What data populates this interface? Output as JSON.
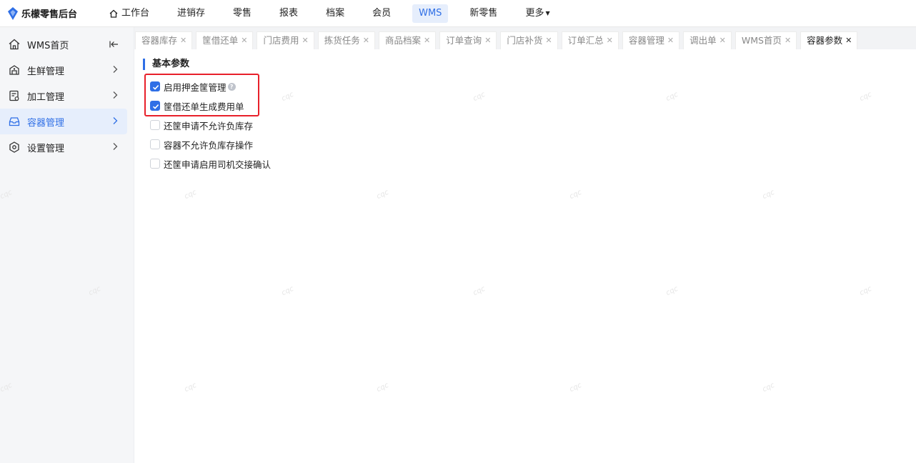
{
  "app": {
    "title": "乐檬零售后台"
  },
  "topnav": [
    {
      "label": "工作台",
      "icon": "home-icon",
      "active": false
    },
    {
      "label": "进销存",
      "active": false
    },
    {
      "label": "零售",
      "active": false
    },
    {
      "label": "报表",
      "active": false
    },
    {
      "label": "档案",
      "active": false
    },
    {
      "label": "会员",
      "active": false
    },
    {
      "label": "WMS",
      "active": true
    },
    {
      "label": "新零售",
      "active": false
    },
    {
      "label": "更多",
      "active": false
    }
  ],
  "sidebar": {
    "items": [
      {
        "label": "WMS首页",
        "icon": "home-outline-icon"
      },
      {
        "label": "生鲜管理",
        "icon": "fresh-icon"
      },
      {
        "label": "加工管理",
        "icon": "process-icon"
      },
      {
        "label": "容器管理",
        "icon": "container-icon",
        "active": true
      },
      {
        "label": "设置管理",
        "icon": "settings-icon"
      }
    ]
  },
  "tabs": [
    {
      "label": "容器库存"
    },
    {
      "label": "筐借还单"
    },
    {
      "label": "门店费用"
    },
    {
      "label": "拣货任务"
    },
    {
      "label": "商品档案"
    },
    {
      "label": "订单查询"
    },
    {
      "label": "门店补货"
    },
    {
      "label": "订单汇总"
    },
    {
      "label": "容器管理"
    },
    {
      "label": "调出单"
    },
    {
      "label": "WMS首页"
    },
    {
      "label": "容器参数",
      "active": true
    }
  ],
  "content": {
    "section_title": "基本参数",
    "options": [
      {
        "label": "启用押金筐管理",
        "checked": true,
        "help": true
      },
      {
        "label": "筐借还单生成费用单",
        "checked": true
      },
      {
        "label": "还筐申请不允许负库存",
        "checked": false
      },
      {
        "label": "容器不允许负库存操作",
        "checked": false
      },
      {
        "label": "还筐申请启用司机交接确认",
        "checked": false
      }
    ]
  },
  "watermark": {
    "text": "cqc"
  },
  "colors": {
    "accent": "#2f6fe6",
    "highlight": "#e8202a",
    "active_bg": "#e6eefc"
  }
}
